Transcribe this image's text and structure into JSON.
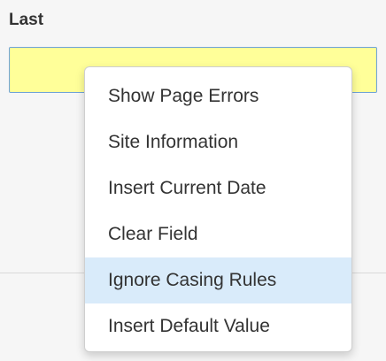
{
  "field": {
    "label": "Last",
    "value": "",
    "background_color": "#ffff99"
  },
  "context_menu": {
    "highlight_color": "#d9ebfa",
    "items": [
      {
        "label": "Show Page Errors",
        "highlighted": false
      },
      {
        "label": "Site Information",
        "highlighted": false
      },
      {
        "label": "Insert Current Date",
        "highlighted": false
      },
      {
        "label": "Clear Field",
        "highlighted": false
      },
      {
        "label": "Ignore Casing Rules",
        "highlighted": true
      },
      {
        "label": "Insert Default Value",
        "highlighted": false
      }
    ]
  }
}
